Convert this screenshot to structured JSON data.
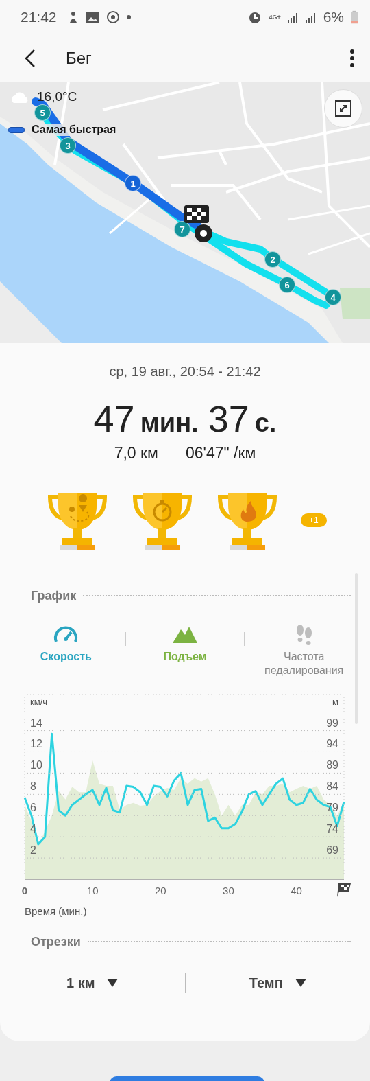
{
  "status_bar": {
    "time": "21:42",
    "network": "4G+",
    "battery": "6%"
  },
  "app_bar": {
    "title": "Бег"
  },
  "map": {
    "weather": "16,0°C",
    "legend": "Самая быстрая",
    "markers": [
      {
        "label": "1",
        "fastest": true
      },
      {
        "label": "2",
        "fastest": false
      },
      {
        "label": "3",
        "fastest": false
      },
      {
        "label": "4",
        "fastest": false
      },
      {
        "label": "5",
        "fastest": false
      },
      {
        "label": "6",
        "fastest": false
      },
      {
        "label": "7",
        "fastest": false
      }
    ]
  },
  "workout": {
    "date": "ср, 19 авг., 20:54 - 21:42",
    "duration": [
      {
        "value": "47",
        "unit": "мин."
      },
      {
        "value": "37",
        "unit": "с."
      }
    ],
    "distance": "7,0 км",
    "pace": "06'47\" /км"
  },
  "achievements": {
    "items": [
      {
        "kind": "route"
      },
      {
        "kind": "stopwatch"
      },
      {
        "kind": "flame"
      }
    ],
    "more": "+1"
  },
  "graph": {
    "title": "График",
    "tabs": [
      {
        "kind": "speed",
        "label": "Скорость",
        "selected": true,
        "color": "#2aa5c1"
      },
      {
        "kind": "elevation",
        "label": "Подъем",
        "selected": true,
        "color": "#7cb342"
      },
      {
        "kind": "cadence",
        "label": "Частота педалирования",
        "selected": false
      }
    ],
    "right_axis": {
      "unit": "м",
      "labels": [
        "99",
        "94",
        "89",
        "84",
        "79",
        "74",
        "69"
      ]
    },
    "chart_data": {
      "type": "line",
      "xlabel": "Время (мин.)",
      "ylabel": "км/ч",
      "grid": true,
      "xlim": [
        0,
        47
      ],
      "xticks": [
        0,
        10,
        20,
        30,
        40
      ],
      "ylim": [
        0,
        17.4
      ],
      "yticks": [
        2,
        4,
        6,
        8,
        10,
        12,
        14
      ],
      "x": [
        0,
        1,
        2,
        3,
        4,
        5,
        6,
        7,
        8,
        9,
        10,
        11,
        12,
        13,
        14,
        15,
        16,
        17,
        18,
        19,
        20,
        21,
        22,
        23,
        24,
        25,
        26,
        27,
        28,
        29,
        30,
        31,
        32,
        33,
        34,
        35,
        36,
        37,
        38,
        39,
        40,
        41,
        42,
        43,
        44,
        45,
        46,
        47
      ],
      "series": [
        {
          "color": "#2ed3e0",
          "values": [
            7.7,
            6,
            3.3,
            4,
            13.7,
            6.5,
            6,
            7,
            7.5,
            8,
            8.4,
            7,
            8.6,
            6.5,
            6.3,
            8.8,
            8.7,
            8.2,
            7,
            8.8,
            8.7,
            7.8,
            9.3,
            10,
            7,
            8.4,
            8.5,
            5.5,
            5.8,
            4.8,
            4.8,
            5.2,
            6.4,
            8,
            8.3,
            7,
            8,
            9,
            9.5,
            7.5,
            7,
            7.2,
            8.5,
            7.5,
            7,
            6.8,
            5,
            7.3
          ]
        }
      ]
    }
  },
  "splits": {
    "title": "Отрезки",
    "dropdowns": [
      "1 км",
      "Темп"
    ]
  }
}
